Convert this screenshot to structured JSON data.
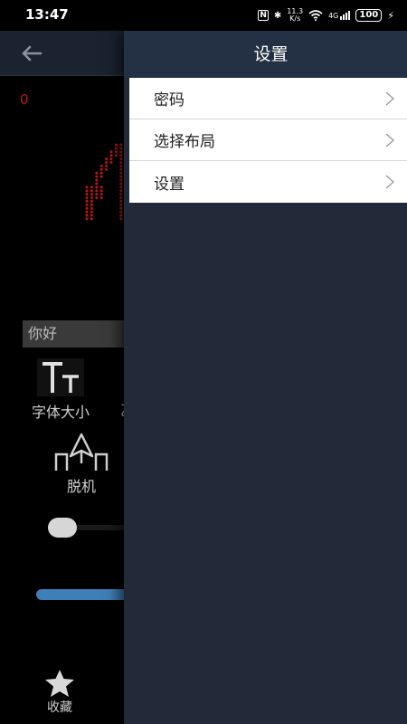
{
  "status_bar": {
    "time": "13:47",
    "nfc": "N",
    "bluetooth": "✱",
    "speed_value": "11.3",
    "speed_unit": "K/s",
    "network": "4G",
    "battery": "100"
  },
  "background": {
    "count": "0",
    "input_value": "你好",
    "tools": {
      "font_size_label": "字体大小",
      "partial_label": "乙",
      "offline_label": "脱机"
    },
    "favorites_label": "收藏"
  },
  "drawer": {
    "title": "设置",
    "items": [
      {
        "label": "密码"
      },
      {
        "label": "选择布局"
      },
      {
        "label": "设置"
      }
    ]
  },
  "colors": {
    "drawer_bg": "#222a39",
    "led_red": "#c0141c",
    "progress_blue": "#3f7fb8"
  }
}
